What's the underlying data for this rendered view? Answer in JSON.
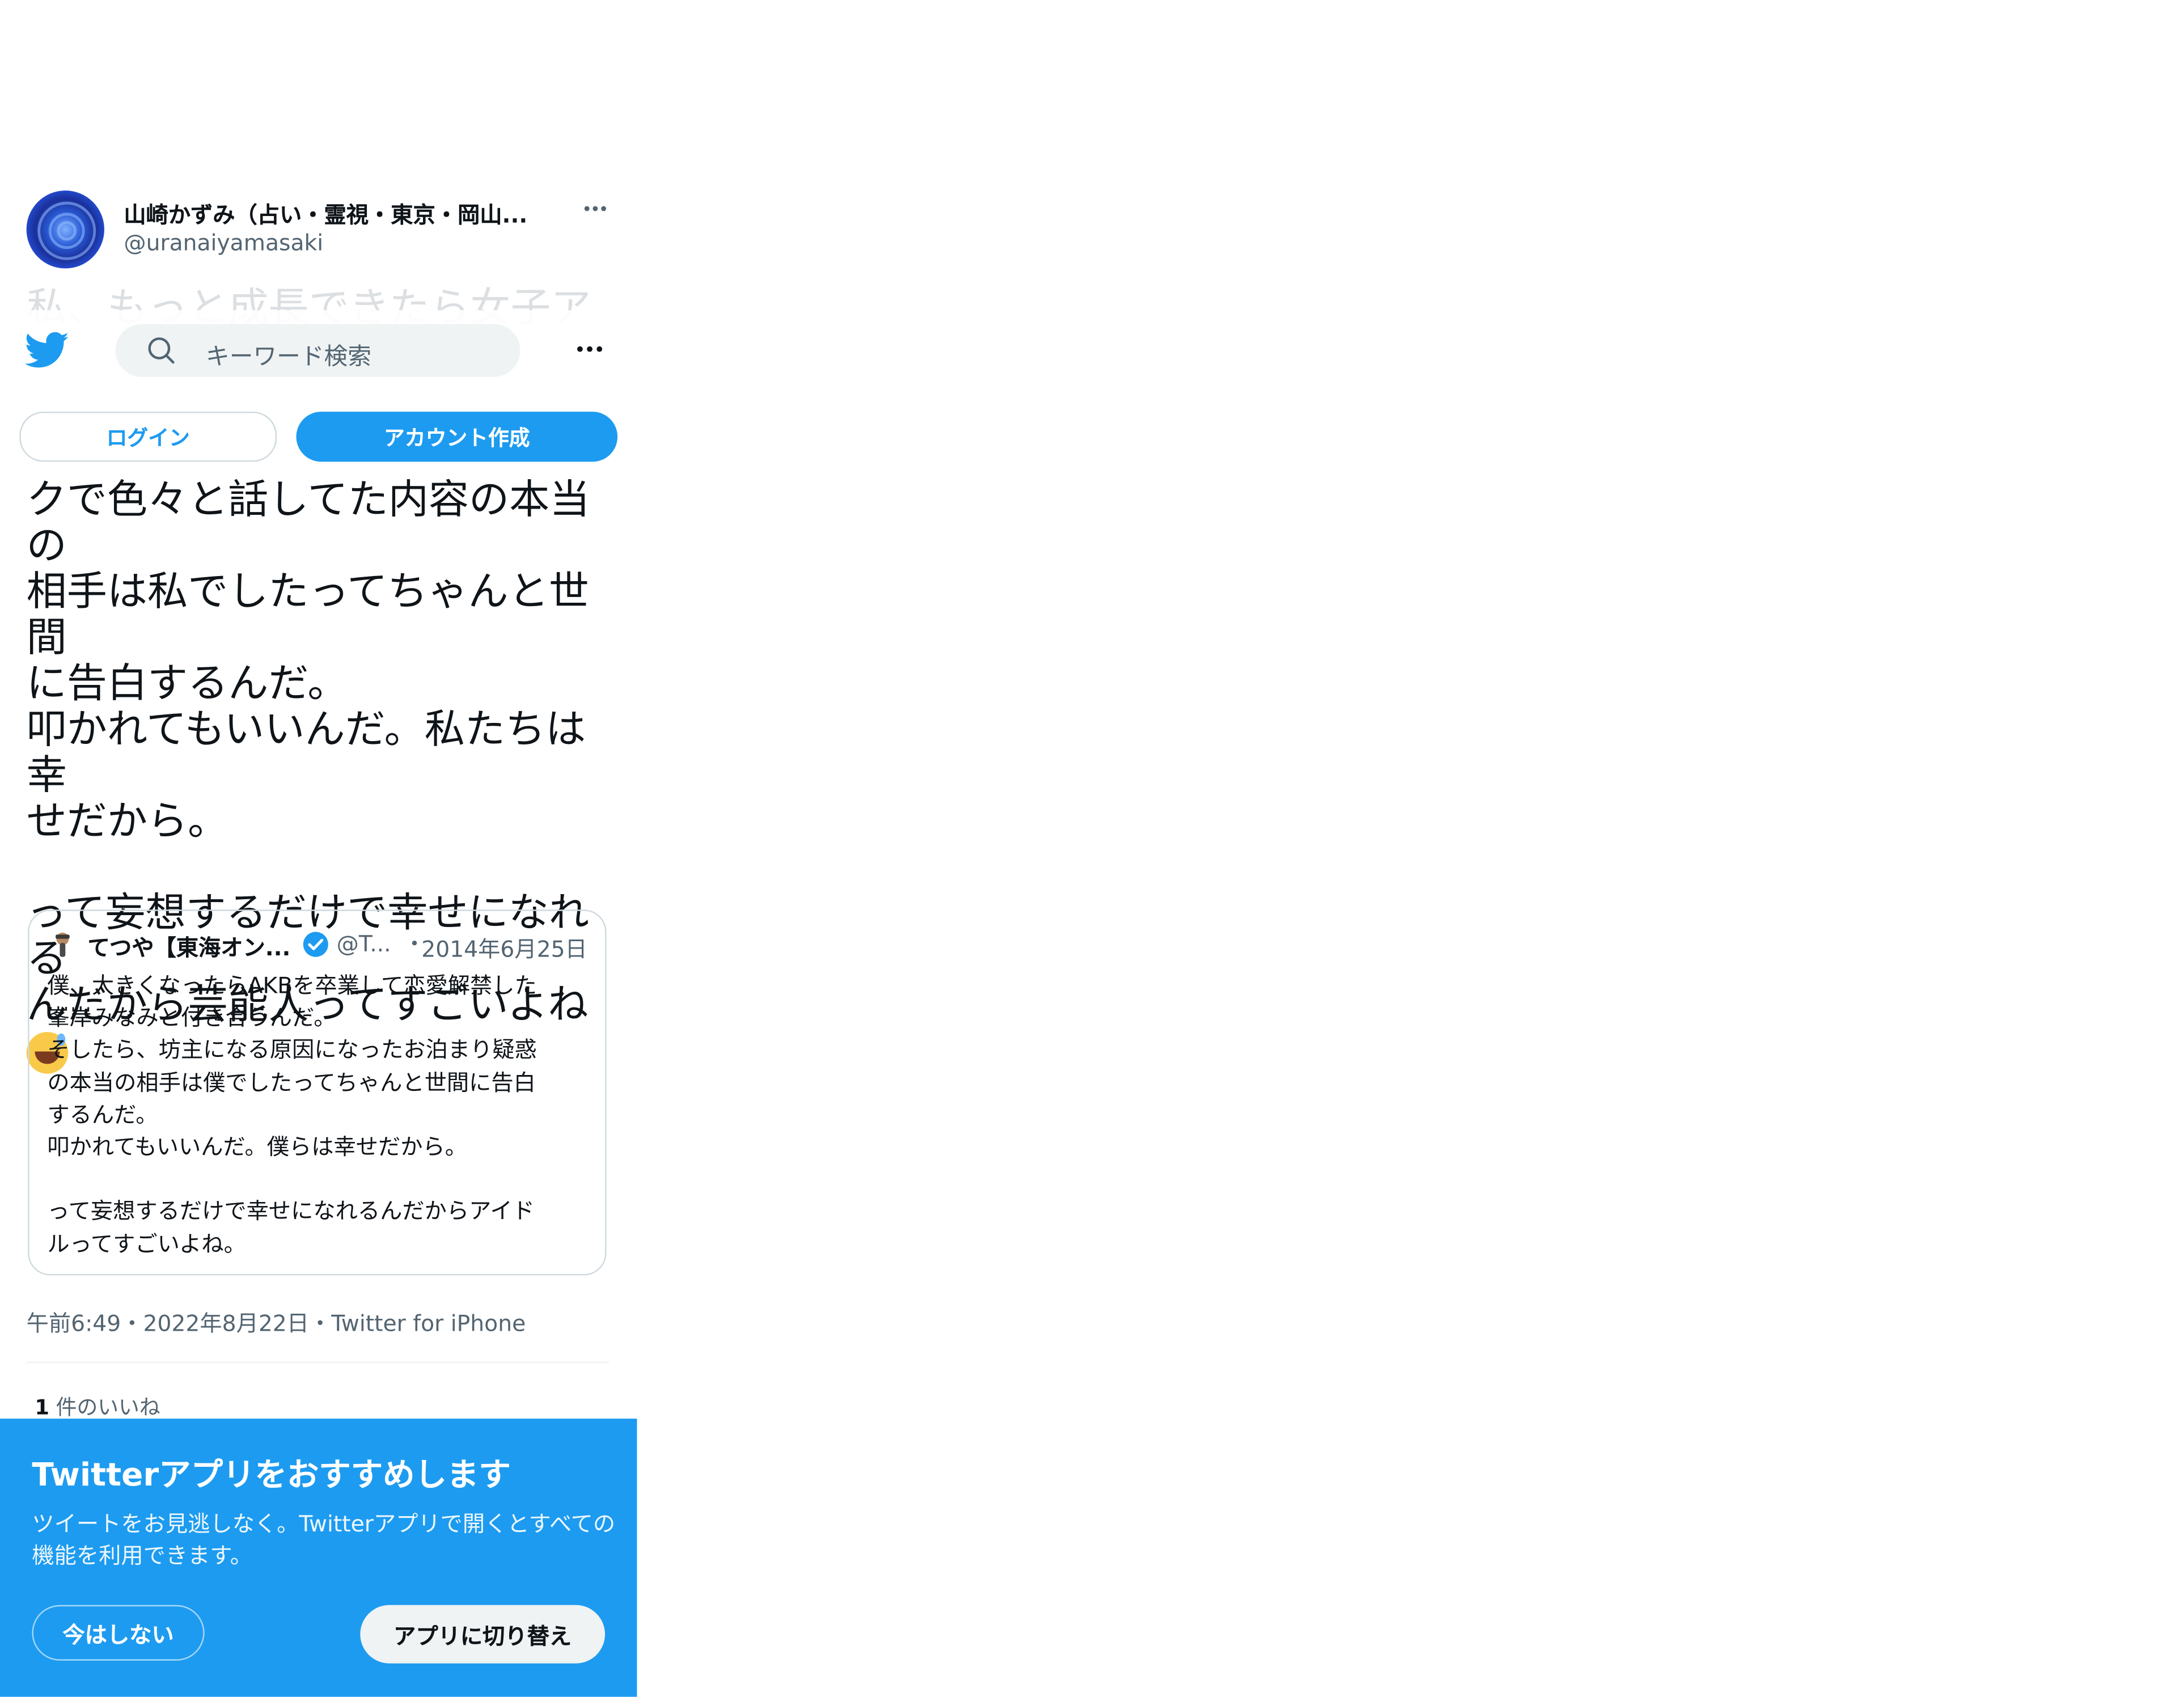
{
  "tweet": {
    "author_name": "山崎かずみ（占い・霊視・東京・岡山...",
    "author_handle": "@uranaiyamasaki",
    "more_icon": "…",
    "body_hidden_line": "私、もっと成長できたら女子アナ",
    "body": "クで色々と話してた内容の本当の\n相手は私でしたってちゃんと世間\nに告白するんだ。\n叩かれてもいいんだ。私たちは幸\nせだから。\n\nって妄想するだけで幸せになれる\nんだから芸能人ってすごいよね",
    "emoji": "grinning-sweat-emoji",
    "meta": "午前6:49・2022年8月22日・Twitter for iPhone",
    "likes_count": "1",
    "likes_label": "件のいいね"
  },
  "quote": {
    "name": "てつや【東海オン...",
    "handle": "@T...",
    "separator": "・",
    "date": "2014年6月25日",
    "text": "僕、大きくなったらAKBを卒業して恋愛解禁した\n峯岸みなみと付き合うんだ。\nそしたら、坊主になる原因になったお泊まり疑惑\nの本当の相手は僕でしたってちゃんと世間に告白\nするんだ。\n叩かれてもいいんだ。僕らは幸せだから。\n\nって妄想するだけで幸せになれるんだからアイド\nルってすごいよね。"
  },
  "header": {
    "search_placeholder": "キーワード検索",
    "more_icon": "•••",
    "login_label": "ログイン",
    "signup_label": "アカウント作成"
  },
  "promo": {
    "title": "Twitterアプリをおすすめします",
    "description": "ツイートをお見逃しなく。Twitterアプリで開くとすべての機能を利用できます。",
    "later_label": "今はしない",
    "switch_label": "アプリに切り替え"
  },
  "colors": {
    "brand": "#1d9bf0",
    "text": "#0f1419",
    "secondary": "#536471"
  }
}
